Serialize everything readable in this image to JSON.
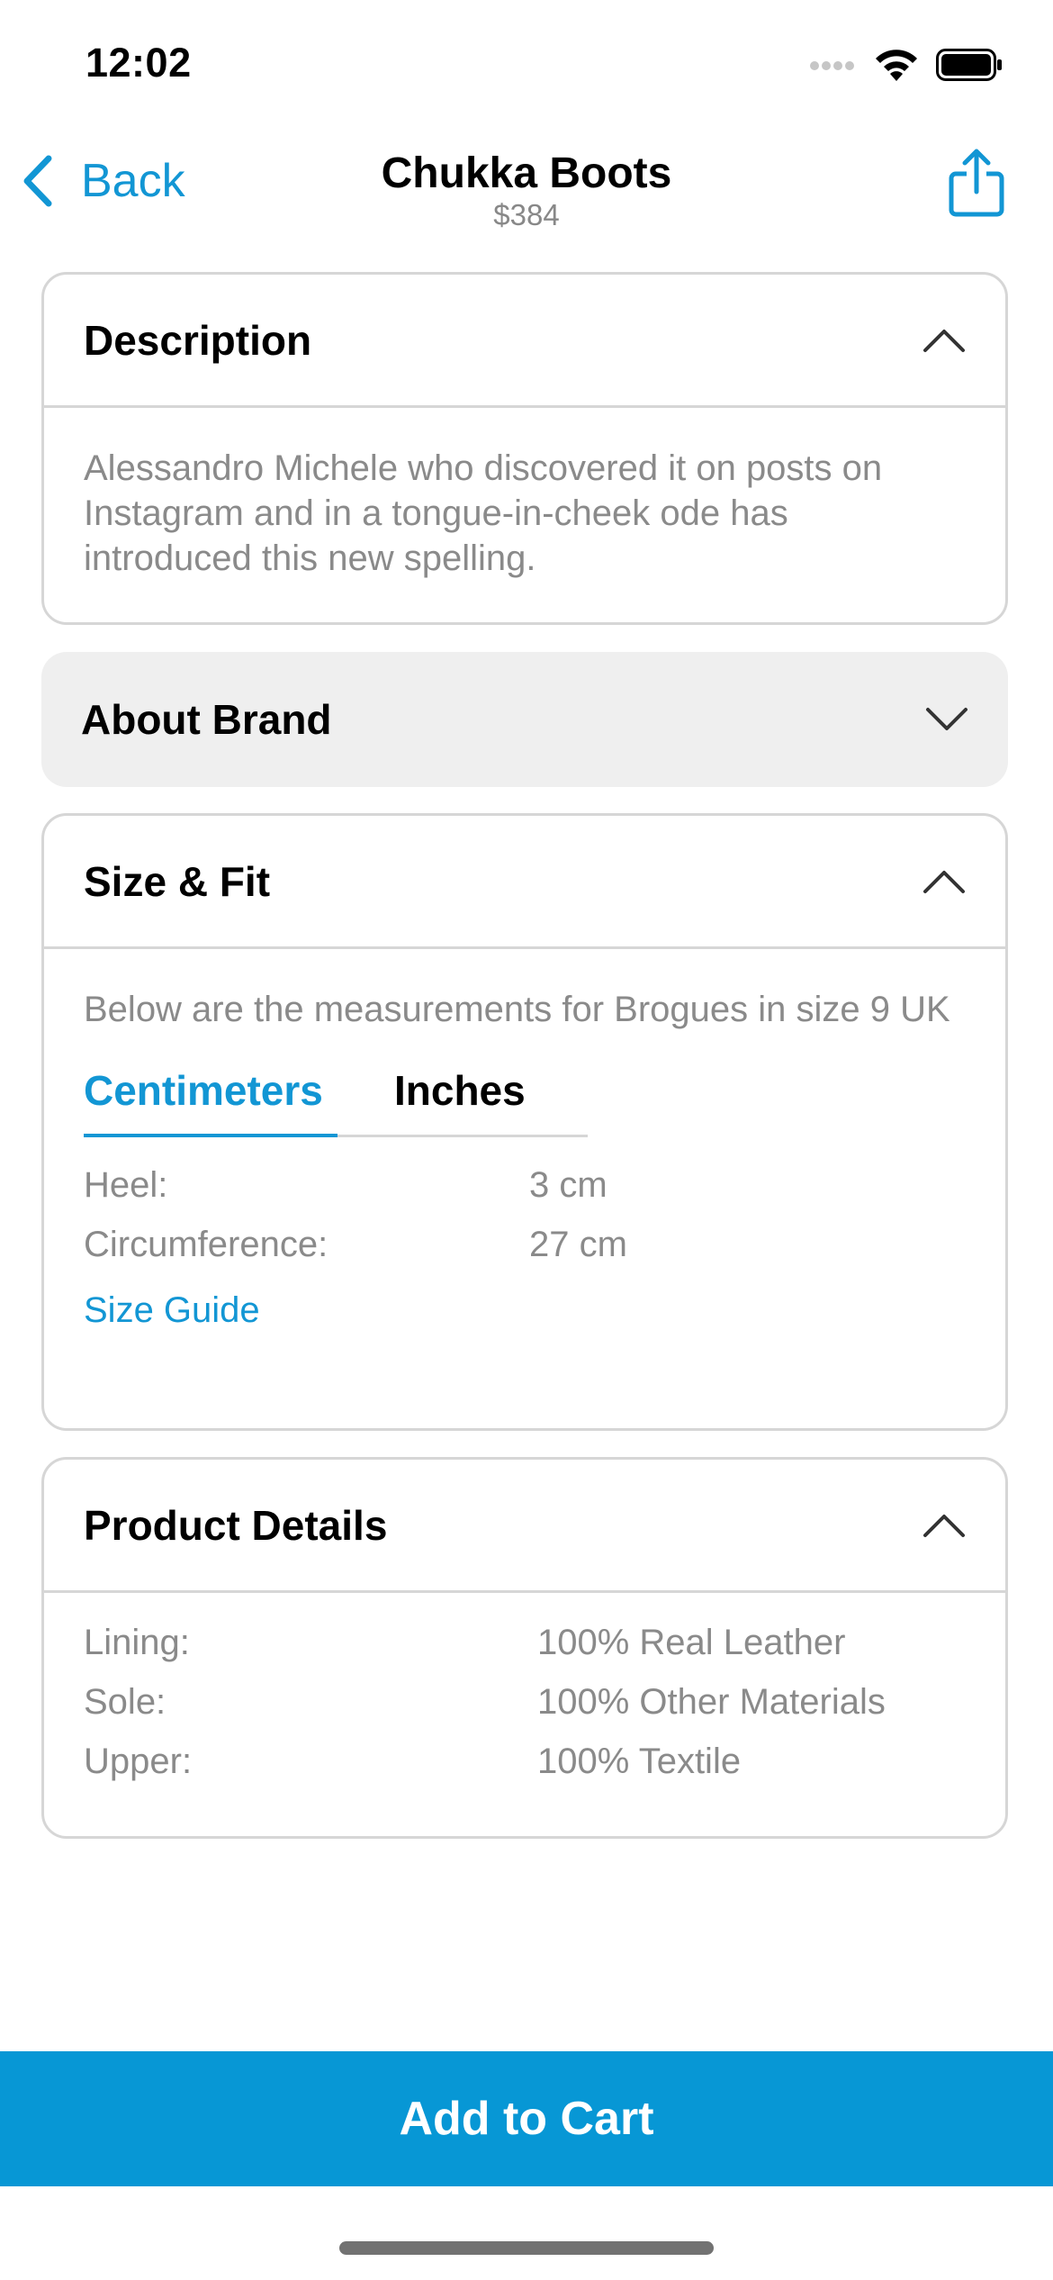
{
  "status_bar": {
    "time": "12:02"
  },
  "nav": {
    "back_label": "Back",
    "title": "Chukka Boots",
    "price": "$384",
    "accent_color": "#1296d4"
  },
  "sections": {
    "description": {
      "title": "Description",
      "text": "Alessandro Michele who discovered it on posts on Instagram and in a tongue-in-cheek ode has introduced this new spelling."
    },
    "about_brand": {
      "title": "About Brand"
    },
    "size_fit": {
      "title": "Size & Fit",
      "intro": "Below are the measurements for Brogues in size 9 UK",
      "tabs": [
        "Centimeters",
        "Inches"
      ],
      "rows": [
        {
          "key": "Heel:",
          "value": "3 cm"
        },
        {
          "key": "Circumference:",
          "value": "27 cm"
        }
      ],
      "guide_link": "Size Guide"
    },
    "product_details": {
      "title": "Product Details",
      "rows": [
        {
          "key": "Lining:",
          "value": "100% Real Leather"
        },
        {
          "key": "Sole:",
          "value": "100% Other Materials"
        },
        {
          "key": "Upper:",
          "value": "100% Textile"
        }
      ]
    }
  },
  "cart_button": {
    "label": "Add to Cart",
    "color": "#0797d5"
  }
}
